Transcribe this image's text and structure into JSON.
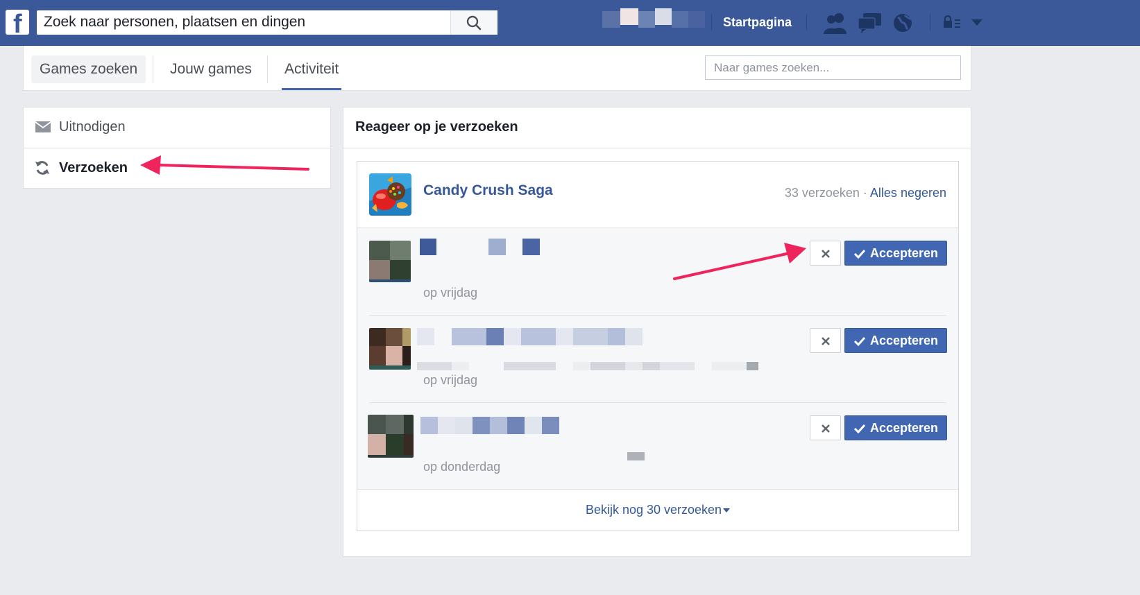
{
  "topbar": {
    "logo": "f",
    "search_value": "Zoek naar personen, plaatsen en dingen",
    "home_label": "Startpagina",
    "brand_color": "#3b5998",
    "icons": [
      "search-icon",
      "friends-icon",
      "messages-icon",
      "notifications-globe-icon",
      "privacy-lock-icon",
      "dropdown-caret-icon"
    ]
  },
  "tabs": {
    "items": [
      {
        "label": "Games zoeken"
      },
      {
        "label": "Jouw games"
      },
      {
        "label": "Activiteit"
      }
    ],
    "active": "Activiteit",
    "search_placeholder": "Naar games zoeken..."
  },
  "sidebar": {
    "items": [
      {
        "label": "Uitnodigen",
        "icon": "envelope-icon"
      },
      {
        "label": "Verzoeken",
        "icon": "refresh-arrows-icon",
        "selected": true
      }
    ]
  },
  "main": {
    "title": "Reageer op je verzoeken",
    "app": {
      "name": "Candy Crush Saga",
      "count": "33 verzoeken",
      "separator": "·",
      "ignore_all": "Alles negeren"
    },
    "requests": [
      {
        "when": "op vrijdag",
        "accept": "Accepteren"
      },
      {
        "when": "op vrijdag",
        "accept": "Accepteren"
      },
      {
        "when": "op donderdag",
        "accept": "Accepteren"
      }
    ],
    "more": "Bekijk nog 30 verzoeken"
  },
  "colors": {
    "accent": "#4267b2",
    "link": "#365899",
    "annotation_arrow": "#f0245c"
  }
}
